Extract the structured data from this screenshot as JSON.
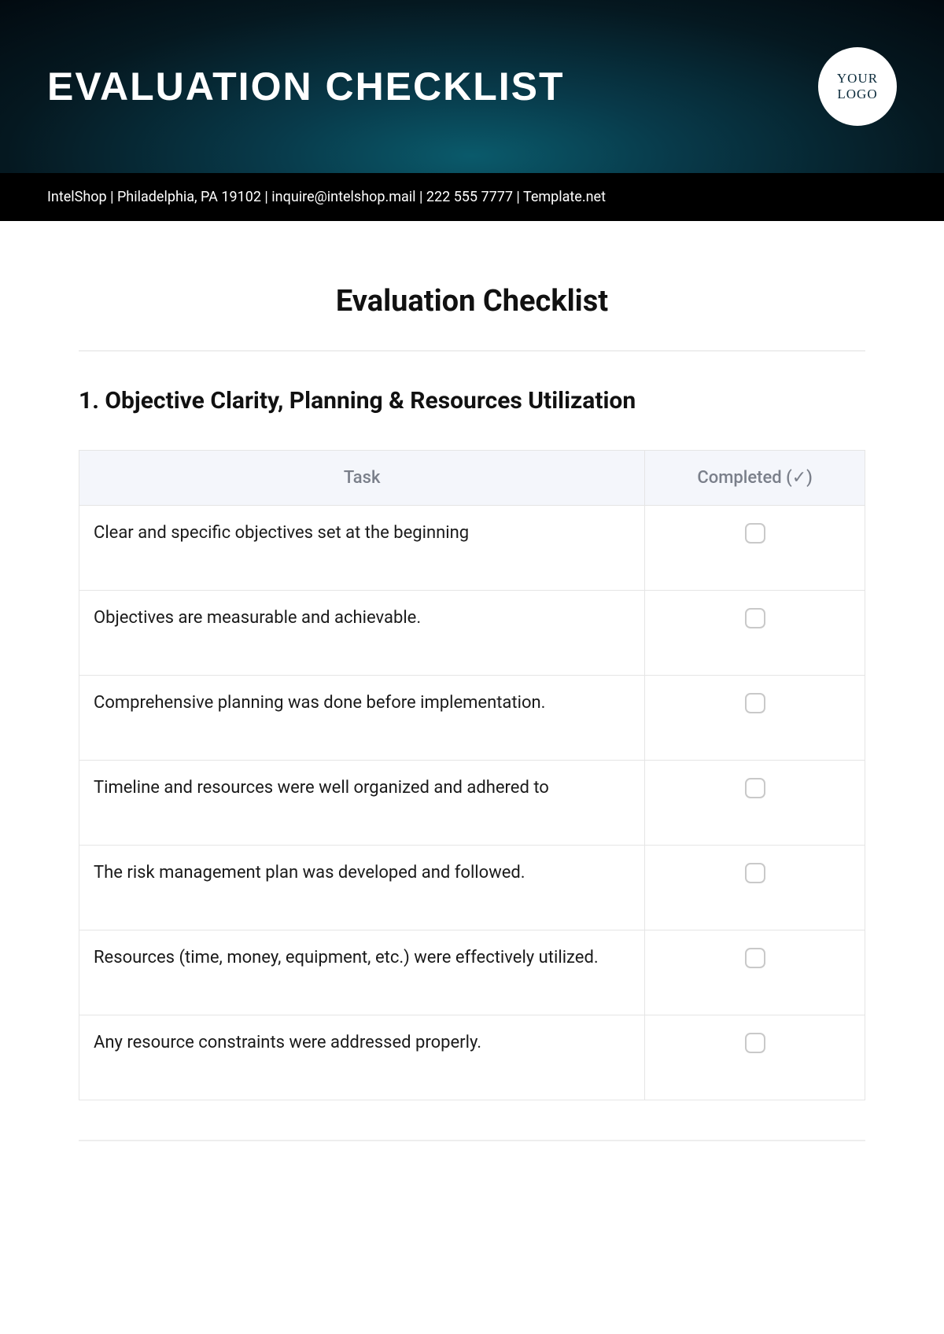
{
  "hero": {
    "title": "EVALUATION CHECKLIST",
    "logo_line1": "YOUR",
    "logo_line2": "LOGO"
  },
  "contact_bar": "IntelShop | Philadelphia, PA 19102 | inquire@intelshop.mail | 222 555 7777 | Template.net",
  "document": {
    "title": "Evaluation Checklist"
  },
  "section1": {
    "heading": "1. Objective Clarity, Planning & Resources Utilization",
    "columns": {
      "task": "Task",
      "completed": "Completed (✓)"
    },
    "rows": [
      {
        "task": "Clear and specific objectives set at the beginning"
      },
      {
        "task": "Objectives are measurable and achievable."
      },
      {
        "task": "Comprehensive planning was done before implementation."
      },
      {
        "task": "Timeline and resources were well organized and adhered to"
      },
      {
        "task": "The risk management plan was developed and followed."
      },
      {
        "task": "Resources (time, money, equipment, etc.) were effectively utilized."
      },
      {
        "task": "Any resource constraints were addressed properly."
      }
    ]
  }
}
